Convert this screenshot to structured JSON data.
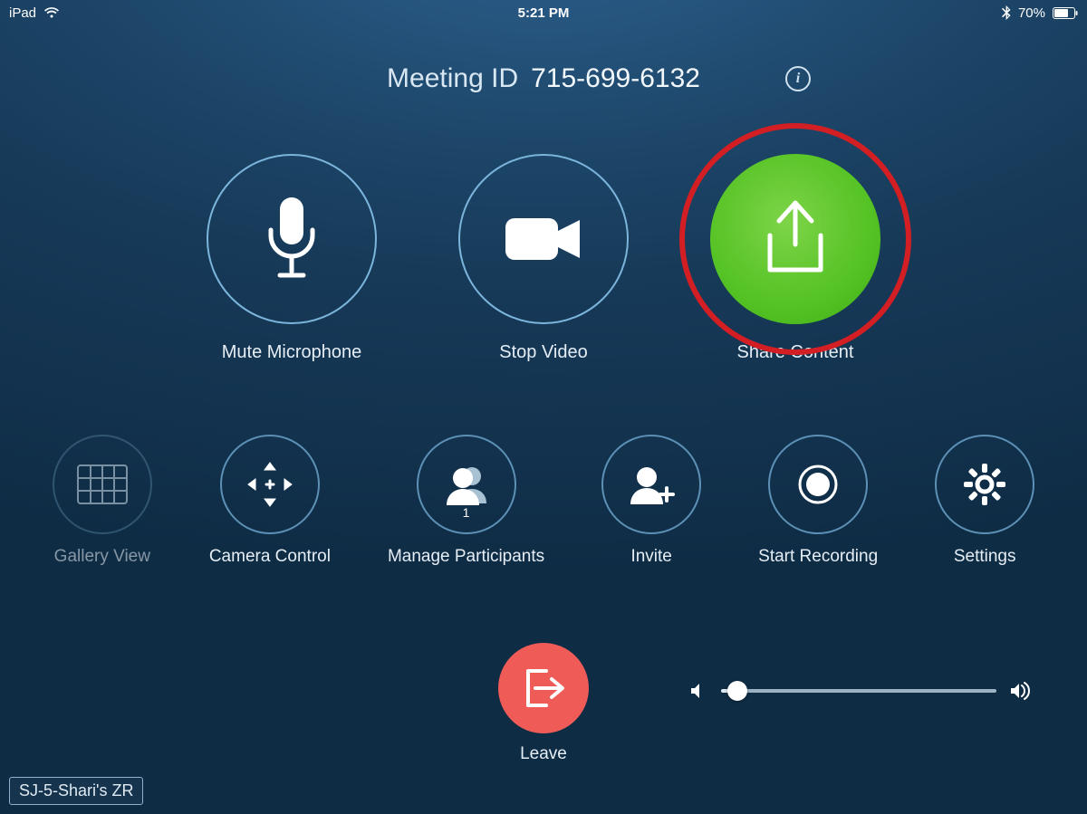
{
  "status": {
    "device": "iPad",
    "time": "5:21 PM",
    "battery_pct": "70%"
  },
  "header": {
    "label": "Meeting ID",
    "meeting_id": "715-699-6132"
  },
  "primary": {
    "mute": "Mute Microphone",
    "video": "Stop Video",
    "share": "Share Content"
  },
  "secondary": {
    "gallery": "Gallery View",
    "camera": "Camera Control",
    "participants": "Manage Participants",
    "participant_count": "1",
    "invite": "Invite",
    "record": "Start Recording",
    "settings": "Settings"
  },
  "leave": {
    "label": "Leave"
  },
  "room": {
    "name": "SJ-5-Shari's ZR"
  },
  "colors": {
    "accent_green": "#58c427",
    "leave_red": "#ef5b57",
    "annotation_red": "#d31f24"
  },
  "annotation": {
    "highlighted_control": "share-content-button"
  }
}
